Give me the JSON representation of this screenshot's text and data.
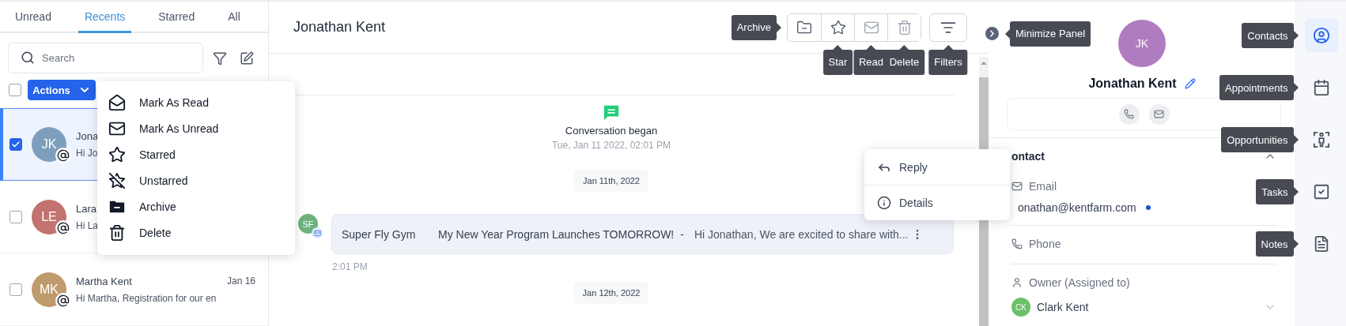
{
  "inbox": {
    "tabs": [
      {
        "label": "Unread",
        "selected": false
      },
      {
        "label": "Recents",
        "selected": true
      },
      {
        "label": "Starred",
        "selected": false
      },
      {
        "label": "All",
        "selected": false
      }
    ],
    "search": {
      "placeholder": "Search"
    },
    "select_all": {
      "checked": false
    },
    "actions_button": "Actions",
    "conversations": [
      {
        "initials": "JK",
        "color": "#7d9fbd",
        "name": "Jona",
        "preview": "Hi Jo",
        "checked": true,
        "selected": true
      },
      {
        "initials": "LE",
        "color": "#c2736f",
        "name": "Lara",
        "preview": "Hi La",
        "checked": false,
        "selected": false
      },
      {
        "initials": "MK",
        "color": "#bf9a6c",
        "name": "Martha Kent",
        "date": "Jan 16",
        "preview": "Hi Martha, Registration for our en",
        "checked": false,
        "selected": false
      }
    ]
  },
  "actions_menu": {
    "items": [
      {
        "kind": "read",
        "label": "Mark As Read"
      },
      {
        "kind": "unread",
        "label": "Mark As Unread"
      },
      {
        "kind": "star",
        "label": "Starred"
      },
      {
        "kind": "unstar",
        "label": "Unstarred"
      },
      {
        "kind": "archive",
        "label": "Archive"
      },
      {
        "kind": "delete",
        "label": "Delete"
      }
    ]
  },
  "conversation": {
    "title": "Jonathan Kent",
    "toolbar": [
      {
        "kind": "archive",
        "disabled": false,
        "tooltip": "Archive"
      },
      {
        "kind": "star",
        "disabled": false,
        "tooltip": "Star"
      },
      {
        "kind": "read",
        "disabled": true,
        "tooltip": "Read"
      },
      {
        "kind": "delete",
        "disabled": true,
        "tooltip": "Delete"
      }
    ],
    "filters_button": {
      "tooltip": "Filters"
    },
    "panel_toggle": {
      "tooltip": "Minimize Panel"
    },
    "timeline": [
      {
        "kind": "event",
        "title": "Conversation began",
        "time": "Tue, Jan 11 2022, 02:01 PM"
      },
      {
        "kind": "date",
        "label": "Jan 11th, 2022"
      },
      {
        "kind": "message",
        "initials": "SF",
        "color": "#6db27f",
        "sender": "Super Fly Gym",
        "subject": "My New Year Program Launches TOMORROW!",
        "separator": "-",
        "snippet": "Hi Jonathan, We are excited to share with...",
        "time": "2:01 PM"
      },
      {
        "kind": "date",
        "label": "Jan 12th, 2022"
      }
    ],
    "message_menu": {
      "items": [
        {
          "kind": "reply",
          "label": "Reply"
        },
        {
          "kind": "details",
          "label": "Details"
        }
      ]
    }
  },
  "contact": {
    "initials": "JK",
    "color": "#b07cc0",
    "name": "Jonathan Kent",
    "section": {
      "title": "ontact",
      "expanded": true,
      "fields": [
        {
          "kind": "email",
          "label": "Email",
          "value": "onathan@kentfarm.com"
        },
        {
          "kind": "phone",
          "label": "Phone"
        },
        {
          "kind": "owner",
          "label": "Owner (Assigned to)",
          "value": "Clark Kent",
          "initials": "CK",
          "color": "#6abf69"
        }
      ]
    }
  },
  "rail": [
    {
      "kind": "contacts",
      "selected": true,
      "tooltip": "Contacts"
    },
    {
      "kind": "appointments",
      "selected": false,
      "tooltip": "Appointments"
    },
    {
      "kind": "opportunities",
      "selected": false,
      "tooltip": "Opportunities"
    },
    {
      "kind": "tasks",
      "selected": false,
      "tooltip": "Tasks"
    },
    {
      "kind": "notes",
      "selected": false,
      "tooltip": "Notes"
    }
  ]
}
